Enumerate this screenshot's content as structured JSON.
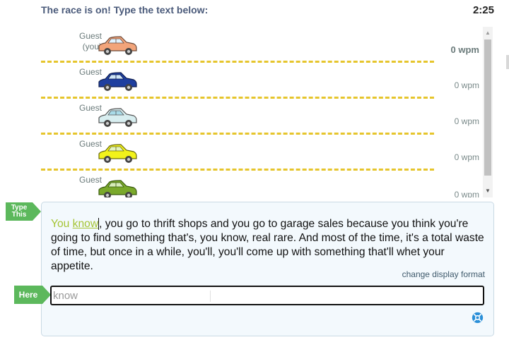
{
  "header": {
    "title": "The race is on! Type the text below:",
    "timer": "2:25"
  },
  "racers": [
    {
      "name_line1": "Guest",
      "name_line2": "(you)",
      "wpm": "0 wpm",
      "car_color": "#f2a47a",
      "car_icon": "car-icon",
      "is_you": true
    },
    {
      "name_line1": "Guest",
      "name_line2": "",
      "wpm": "0 wpm",
      "car_color": "#1f3f9f",
      "car_icon": "car-icon",
      "is_you": false
    },
    {
      "name_line1": "Guest",
      "name_line2": "",
      "wpm": "0 wpm",
      "car_color": "#d8eef0",
      "car_icon": "car-icon",
      "is_you": false
    },
    {
      "name_line1": "Guest",
      "name_line2": "",
      "wpm": "0 wpm",
      "car_color": "#f2f21a",
      "car_icon": "car-icon",
      "is_you": false
    },
    {
      "name_line1": "Guest",
      "name_line2": "",
      "wpm": "0 wpm",
      "car_color": "#7aa92b",
      "car_icon": "car-icon",
      "is_you": false
    }
  ],
  "tags": {
    "type_this": "Type This",
    "here": "Here"
  },
  "passage": {
    "typed": "You",
    "space": " ",
    "current_word": "know",
    "remaining": ", you go to thrift shops and you go to garage sales because you think you're going to find something that's, you know, real rare. And most of the time, it's a total waste of time, but once in a while, you'll, you'll come up with something that'll whet your appetite."
  },
  "change_display_format": "change display format",
  "input": {
    "value": "know",
    "placeholder": ""
  },
  "colors": {
    "accent_green": "#5cb85c",
    "typed_text": "#a5c434",
    "lane_line": "#e6c52c",
    "help_icon": "#2a8fd8"
  },
  "icons": {
    "help": "help-lifebuoy-icon",
    "scroll_up": "triangle-up-icon",
    "scroll_down": "triangle-down-icon"
  }
}
